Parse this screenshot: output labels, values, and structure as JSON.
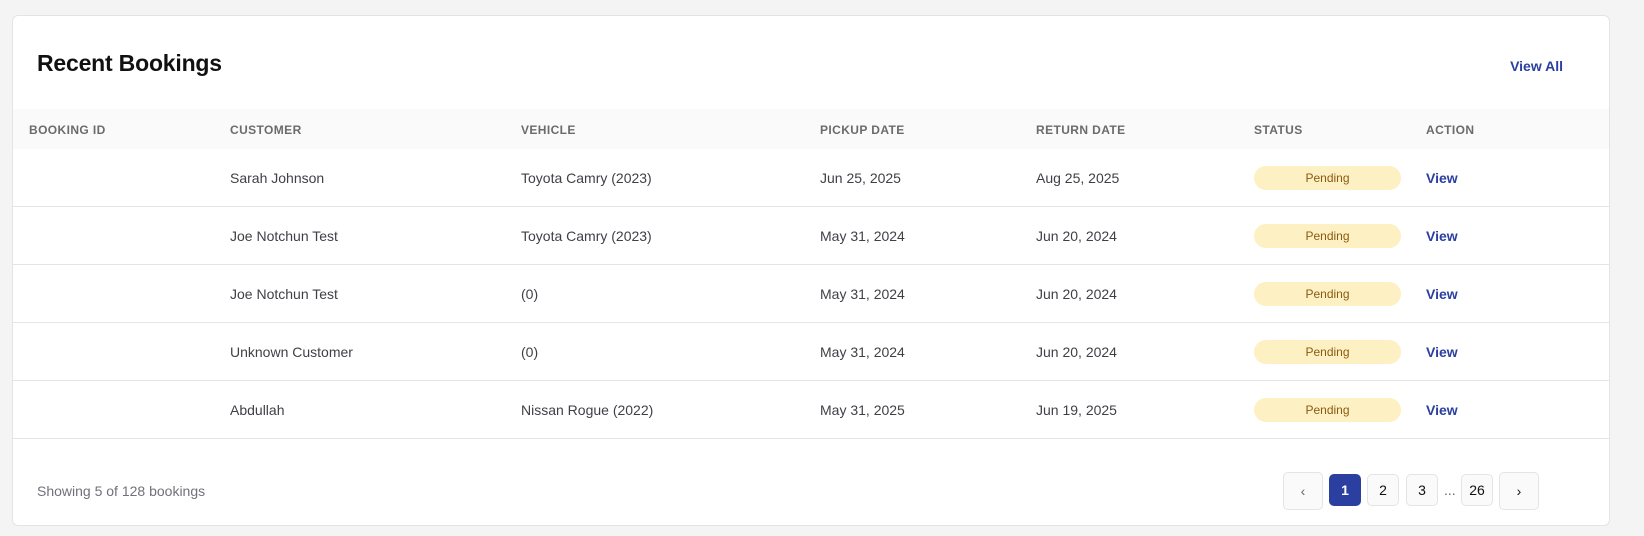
{
  "card": {
    "title": "Recent Bookings",
    "view_all_label": "View All"
  },
  "table": {
    "headers": {
      "booking_id": "BOOKING ID",
      "customer": "CUSTOMER",
      "vehicle": "VEHICLE",
      "pickup_date": "PICKUP DATE",
      "return_date": "RETURN DATE",
      "status": "STATUS",
      "action": "ACTION"
    },
    "rows": [
      {
        "booking_id": "",
        "customer": "Sarah Johnson",
        "vehicle": "Toyota Camry (2023)",
        "pickup_date": "Jun 25, 2025",
        "return_date": "Aug 25, 2025",
        "status": "Pending",
        "action": "View"
      },
      {
        "booking_id": "",
        "customer": "Joe Notchun Test",
        "vehicle": "Toyota Camry (2023)",
        "pickup_date": "May 31, 2024",
        "return_date": "Jun 20, 2024",
        "status": "Pending",
        "action": "View"
      },
      {
        "booking_id": "",
        "customer": "Joe Notchun Test",
        "vehicle": "(0)",
        "pickup_date": "May 31, 2024",
        "return_date": "Jun 20, 2024",
        "status": "Pending",
        "action": "View"
      },
      {
        "booking_id": "",
        "customer": "Unknown Customer",
        "vehicle": "(0)",
        "pickup_date": "May 31, 2024",
        "return_date": "Jun 20, 2024",
        "status": "Pending",
        "action": "View"
      },
      {
        "booking_id": "",
        "customer": "Abdullah",
        "vehicle": "Nissan Rogue (2022)",
        "pickup_date": "May 31, 2025",
        "return_date": "Jun 19, 2025",
        "status": "Pending",
        "action": "View"
      }
    ]
  },
  "footer": {
    "showing_text": "Showing 5 of 128 bookings"
  },
  "pagination": {
    "prev_icon": "chevron-left-icon",
    "prev_glyph": "‹",
    "pages": [
      "1",
      "2",
      "3"
    ],
    "ellipsis": "...",
    "last_page": "26",
    "current_page": "1",
    "next_icon": "chevron-right-icon",
    "next_glyph": "›"
  },
  "colors": {
    "accent": "#2a3fa0",
    "pending_bg": "#fdf0c2",
    "pending_text": "#8a5a13"
  }
}
